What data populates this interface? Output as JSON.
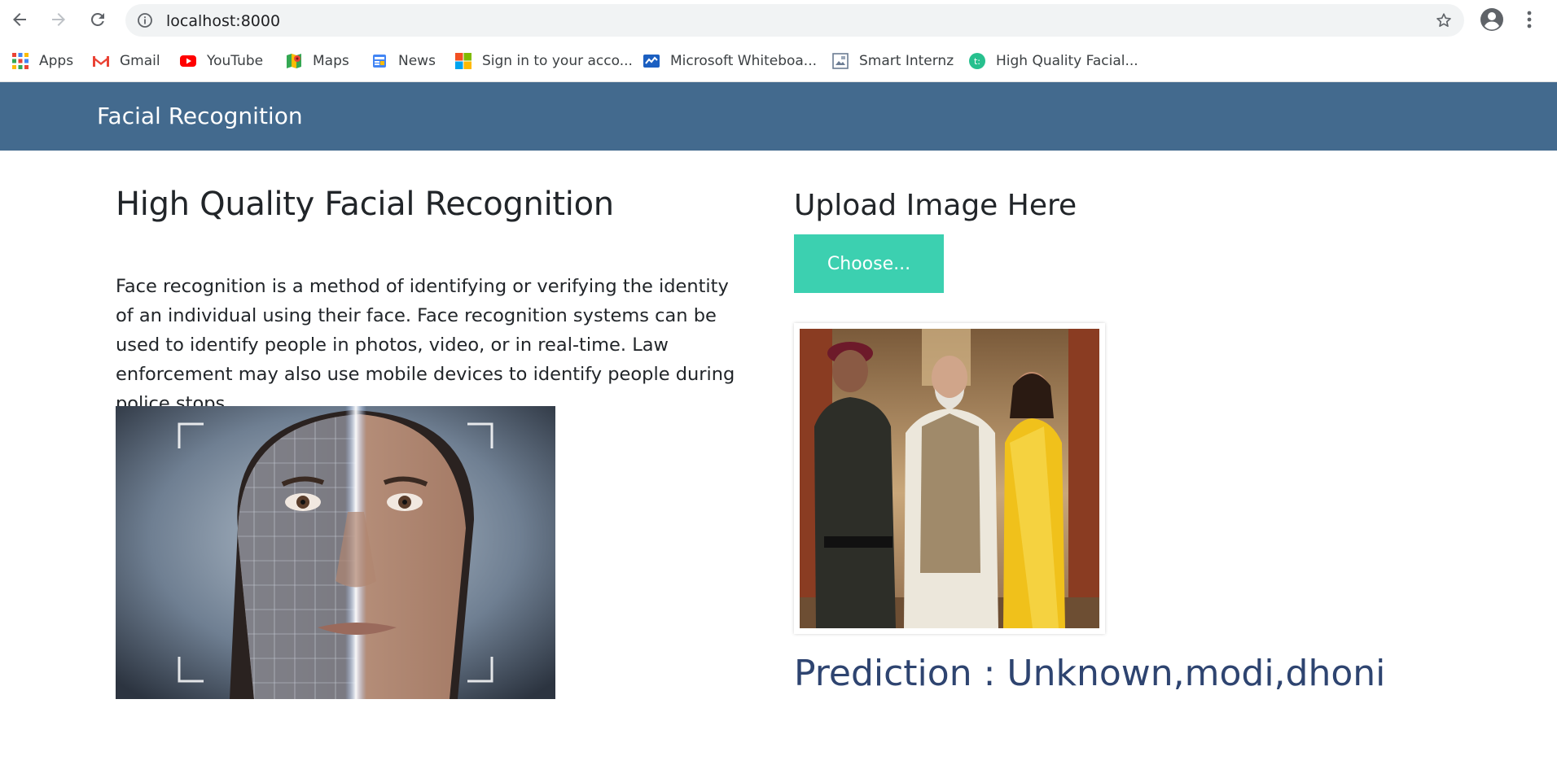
{
  "browser": {
    "url": "localhost:8000",
    "bookmarks": [
      {
        "label": "Apps",
        "icon": "apps-grid-icon"
      },
      {
        "label": "Gmail",
        "icon": "gmail-icon"
      },
      {
        "label": "YouTube",
        "icon": "youtube-icon"
      },
      {
        "label": "Maps",
        "icon": "maps-icon"
      },
      {
        "label": "News",
        "icon": "news-icon"
      },
      {
        "label": "Sign in to your acco...",
        "icon": "microsoft-icon"
      },
      {
        "label": "Microsoft Whiteboa...",
        "icon": "whiteboard-icon"
      },
      {
        "label": "Smart Internz",
        "icon": "page-icon"
      },
      {
        "label": "High Quality Facial...",
        "icon": "site-icon"
      }
    ]
  },
  "navbar": {
    "brand": "Facial Recognition",
    "color": "#436a8e"
  },
  "main": {
    "headline": "High Quality Facial Recognition",
    "intro": "Face recognition is a method of identifying or verifying the identity of an individual using their face. Face recognition systems can be used to identify people in photos, video, or in real-time. Law enforcement may also use mobile devices to identify people during police stops."
  },
  "upload": {
    "title": "Upload Image Here",
    "choose_label": "Choose...",
    "button_color": "#3cd0b0",
    "prediction": "Prediction : Unknown,modi,dhoni",
    "prediction_color": "#2e4470"
  }
}
